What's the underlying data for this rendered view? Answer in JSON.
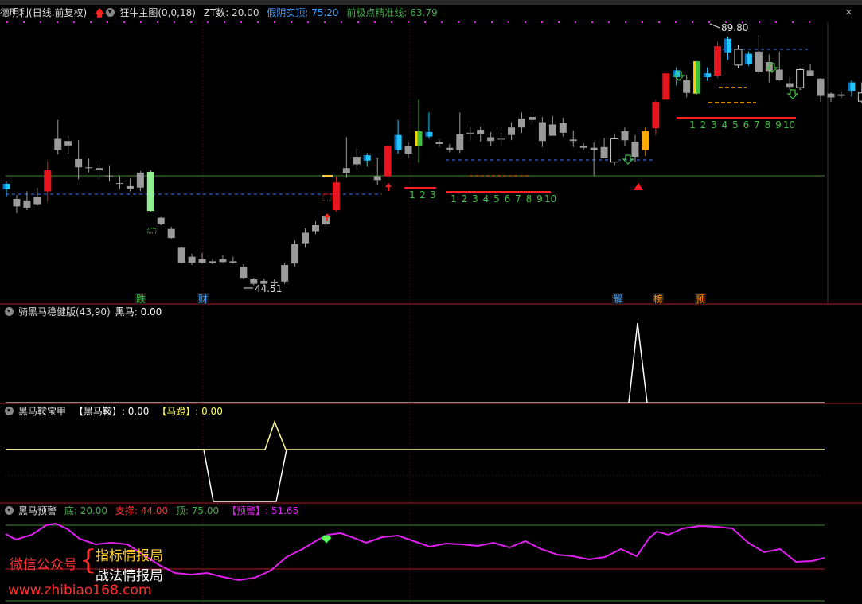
{
  "main_panel": {
    "stock_name": "德明利",
    "period": "(日线.前复权)",
    "indicator": "狂牛主图(0,0,18)",
    "zt_label": "ZT数: 20.00",
    "false_yin": "假阴实顶: 75.20",
    "precise_line": "前极点精准线: 63.79",
    "high_label": "89.80",
    "low_label": "44.51",
    "count_a": [
      "1",
      "2",
      "3"
    ],
    "count_b": [
      "1",
      "2",
      "3",
      "4",
      "5",
      "6",
      "7",
      "8",
      "9",
      "10"
    ],
    "count_c": [
      "1",
      "2",
      "3",
      "4",
      "5",
      "6",
      "7",
      "8",
      "9",
      "10"
    ],
    "events": [
      "跌",
      "财",
      "解",
      "榜",
      "预"
    ]
  },
  "panel2": {
    "title": "骑黑马稳健版(43,90)",
    "value": "黑马: 0.00"
  },
  "panel3": {
    "title": "黑马鞍宝甲",
    "saddle": "【黑马鞍】: 0.00",
    "stirrup": "【马蹬】: 0.00"
  },
  "panel4": {
    "title": "黑马预警",
    "bottom": "底: 20.00",
    "support": "支撑: 44.00",
    "top": "顶: 75.00",
    "warn": "【预警】: 51.65"
  },
  "watermark": {
    "wechat": "微信公众号",
    "line1": "指标情报局",
    "line2": "战法情报局",
    "url": "www.zhibiao168.com"
  },
  "colors": {
    "up_red": "#e8141e",
    "down_blue": "#1ec8ff",
    "green": "#2ecc40",
    "magenta": "#e020f0",
    "yellow": "#ffff99"
  },
  "chart_data": {
    "type": "candlestick",
    "candles": [
      [
        70.5,
        69.8,
        70.8,
        68.7,
        "b"
      ],
      [
        68.5,
        67.5,
        69.0,
        66.6,
        "g"
      ],
      [
        67.3,
        68.3,
        69.5,
        67.0,
        "g"
      ],
      [
        67.8,
        68.8,
        70.0,
        67.6,
        "g"
      ],
      [
        69.5,
        72.3,
        73.5,
        68.2,
        "r"
      ],
      [
        75.0,
        76.5,
        79.0,
        74.4,
        "g"
      ],
      [
        75.6,
        76.2,
        76.9,
        74.5,
        "g"
      ],
      [
        72.7,
        73.8,
        76.3,
        71.1,
        "g"
      ],
      [
        72.7,
        72.7,
        73.9,
        72.0,
        "g"
      ],
      [
        72.6,
        72.3,
        73.1,
        71.2,
        "g"
      ],
      [
        71.6,
        71.6,
        73.0,
        70.8,
        "g"
      ],
      [
        70.6,
        70.5,
        71.5,
        69.8,
        "g"
      ],
      [
        70.2,
        69.8,
        71.2,
        69.5,
        "g"
      ],
      [
        72.0,
        70.0,
        72.2,
        69.5,
        "g"
      ],
      [
        72.1,
        66.9,
        72.3,
        66.8,
        "lg"
      ],
      [
        66.0,
        65.1,
        66.1,
        65.0,
        "g"
      ],
      [
        64.5,
        63.3,
        64.8,
        63.2,
        "g"
      ],
      [
        62.0,
        60.0,
        62.1,
        59.9,
        "g"
      ],
      [
        60.8,
        60.0,
        61.2,
        59.7,
        "g"
      ],
      [
        60.5,
        60.0,
        61.3,
        59.9,
        "g"
      ],
      [
        60.2,
        60.0,
        60.5,
        59.8,
        "g"
      ],
      [
        60.5,
        60.1,
        61.0,
        60.0,
        "g"
      ],
      [
        60.2,
        60.0,
        60.8,
        59.9,
        "g"
      ],
      [
        59.5,
        58.0,
        59.8,
        57.8,
        "g"
      ],
      [
        57.8,
        57.2,
        58.0,
        57.0,
        "g"
      ],
      [
        57.6,
        57.2,
        57.9,
        57.0,
        "g"
      ],
      [
        57.5,
        57.3,
        57.8,
        57.0,
        "g"
      ],
      [
        57.5,
        59.7,
        60.0,
        57.2,
        "g"
      ],
      [
        59.9,
        62.5,
        63.0,
        59.5,
        "g"
      ],
      [
        62.6,
        64.0,
        64.6,
        62.0,
        "g"
      ],
      [
        64.2,
        65.0,
        65.5,
        63.8,
        "g"
      ],
      [
        65.1,
        66.2,
        66.4,
        64.8,
        "g"
      ],
      [
        67.0,
        70.7,
        71.5,
        66.8,
        "r"
      ],
      [
        71.9,
        72.6,
        76.7,
        71.3,
        "g"
      ],
      [
        73.1,
        74.1,
        75.2,
        72.4,
        "g"
      ],
      [
        74.3,
        73.6,
        74.6,
        72.8,
        "b"
      ],
      [
        71.0,
        71.5,
        74.0,
        70.4,
        "g"
      ],
      [
        71.5,
        75.5,
        75.6,
        71.4,
        "r"
      ],
      [
        77.0,
        75.0,
        79.0,
        74.5,
        "b"
      ],
      [
        75.5,
        74.5,
        76.0,
        74.0,
        "g"
      ],
      [
        75.5,
        77.5,
        81.7,
        73.3,
        "lgreen"
      ],
      [
        77.4,
        76.8,
        80.0,
        76.5,
        "b"
      ],
      [
        76.0,
        75.8,
        76.4,
        75.4,
        "g"
      ],
      [
        75.0,
        75.3,
        75.8,
        74.7,
        "g"
      ],
      [
        75.0,
        77.1,
        80.0,
        74.6,
        "g"
      ],
      [
        77.3,
        77.3,
        78.2,
        76.3,
        "g"
      ],
      [
        77.1,
        77.7,
        78.1,
        76.1,
        "g"
      ],
      [
        76.7,
        76.2,
        77.4,
        75.5,
        "g"
      ],
      [
        76.5,
        76.5,
        77.3,
        75.5,
        "g"
      ],
      [
        77.0,
        78.0,
        78.7,
        76.3,
        "g"
      ],
      [
        78.0,
        79.2,
        80.0,
        77.3,
        "g"
      ],
      [
        79.4,
        79.0,
        80.1,
        78.3,
        "g"
      ],
      [
        78.7,
        76.2,
        79.4,
        75.4,
        "g"
      ],
      [
        76.9,
        78.4,
        79.5,
        76.9,
        "g"
      ],
      [
        78.6,
        77.3,
        79.3,
        76.8,
        "g"
      ],
      [
        76.4,
        76.2,
        77.6,
        75.4,
        "g"
      ],
      [
        75.5,
        75.3,
        75.9,
        75.0,
        "g"
      ],
      [
        75.3,
        75.0,
        76.0,
        71.6,
        "g"
      ],
      [
        75.4,
        73.9,
        76.6,
        73.9,
        "g"
      ],
      [
        73.4,
        76.5,
        77.2,
        73.0,
        "b2"
      ],
      [
        76.3,
        77.5,
        78.0,
        75.5,
        "g"
      ],
      [
        74.1,
        76.1,
        77.0,
        73.4,
        "g"
      ],
      [
        75.0,
        77.5,
        78.0,
        74.2,
        "y"
      ],
      [
        77.9,
        81.4,
        81.6,
        77.0,
        "r"
      ],
      [
        81.7,
        85.2,
        85.2,
        81.7,
        "r"
      ],
      [
        85.6,
        84.7,
        86.0,
        83.6,
        "b"
      ],
      [
        82.6,
        84.3,
        85.0,
        82.0,
        "g"
      ],
      [
        82.5,
        86.8,
        86.9,
        82.3,
        "lgreen"
      ],
      [
        85.2,
        84.7,
        86.0,
        84.2,
        "b"
      ],
      [
        84.9,
        88.8,
        89.4,
        84.6,
        "r"
      ],
      [
        89.8,
        88.0,
        90.1,
        87.0,
        "b"
      ],
      [
        88.4,
        86.3,
        89.0,
        85.9,
        "wg"
      ],
      [
        86.5,
        87.8,
        88.1,
        86.2,
        "b"
      ],
      [
        88.1,
        85.4,
        90.3,
        85.1,
        "g"
      ],
      [
        85.5,
        86.7,
        87.7,
        84.0,
        "g"
      ],
      [
        85.7,
        84.3,
        88.1,
        84.2,
        "g"
      ],
      [
        83.9,
        83.4,
        84.7,
        83.0,
        "g"
      ],
      [
        83.3,
        85.7,
        85.9,
        83.0,
        "wg"
      ],
      [
        85.6,
        84.8,
        86.5,
        84.8,
        "g"
      ],
      [
        84.5,
        82.2,
        84.6,
        81.4,
        "g"
      ],
      [
        82.0,
        82.5,
        82.7,
        81.4,
        "g"
      ],
      [
        82.4,
        82.2,
        82.8,
        81.9,
        "g"
      ],
      [
        82.9,
        84.0,
        84.3,
        82.1,
        "b"
      ],
      [
        81.5,
        82.6,
        84.0,
        81.2,
        "wg"
      ]
    ],
    "high": 89.8,
    "low": 44.51
  }
}
